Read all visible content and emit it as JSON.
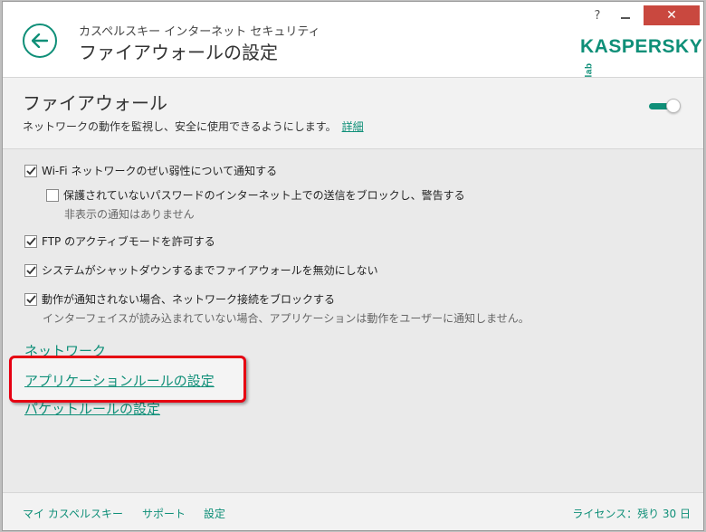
{
  "header": {
    "app_name": "カスペルスキー インターネット セキュリティ",
    "page_title": "ファイアウォールの設定",
    "help_label": "?",
    "close_label": "✕",
    "logo_text": "KASPERSKY",
    "logo_suffix": "lab"
  },
  "section": {
    "title": "ファイアウォール",
    "description": "ネットワークの動作を監視し、安全に使用できるようにします。",
    "details_link": "詳細",
    "enabled": true
  },
  "options": [
    {
      "label": "Wi-Fi ネットワークのぜい弱性について通知する",
      "checked": true
    },
    {
      "label": "保護されていないパスワードのインターネット上での送信をブロックし、警告する",
      "checked": false,
      "note": "非表示の通知はありません"
    },
    {
      "label": "FTP のアクティブモードを許可する",
      "checked": true
    },
    {
      "label": "システムがシャットダウンするまでファイアウォールを無効にしない",
      "checked": true
    },
    {
      "label": "動作が通知されない場合、ネットワーク接続をブロックする",
      "checked": true,
      "note": "インターフェイスが読み込まれていない場合、アプリケーションは動作をユーザーに通知しません。"
    }
  ],
  "links": {
    "network": "ネットワーク",
    "app_rules": "アプリケーションルールの設定",
    "packet_rules": "パケットルールの設定"
  },
  "footer": {
    "my_kaspersky": "マイ カスペルスキー",
    "support": "サポート",
    "settings": "設定",
    "license": "ライセンス：残り 30 日"
  },
  "colors": {
    "accent": "#0f8f78",
    "highlight": "#e60012"
  }
}
